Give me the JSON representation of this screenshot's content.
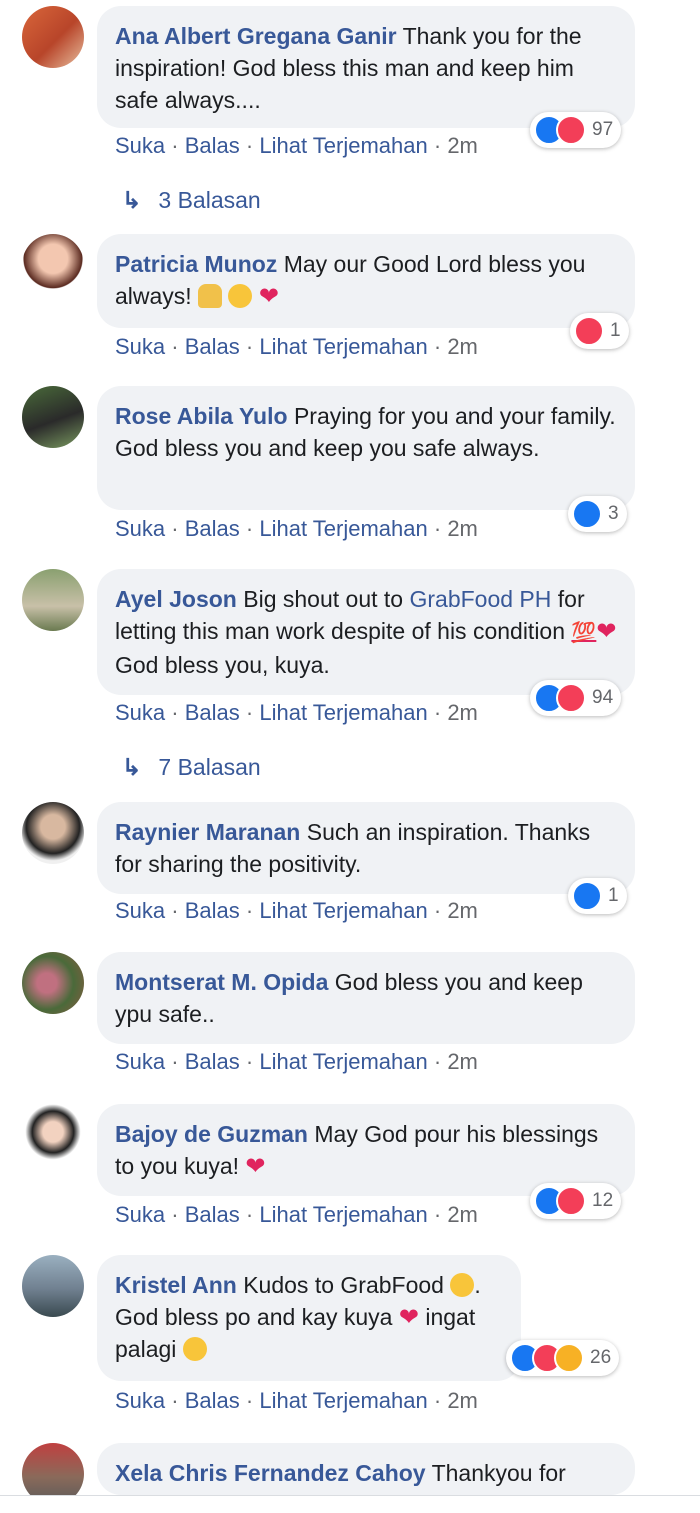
{
  "comments": [
    {
      "author": "Ana Albert Gregana Ganir",
      "text": "Thank you for the inspiration! God bless this man and keep him safe always....",
      "reactions": [
        "like",
        "love"
      ],
      "count": "97",
      "replies": "3 Balasan"
    },
    {
      "author": "Patricia Munoz",
      "text": "May our Good Lord bless you always!",
      "emojis": [
        "pray",
        "smile",
        "heart-gift"
      ],
      "reactions": [
        "love"
      ],
      "count": "1"
    },
    {
      "author": "Rose Abila Yulo",
      "text": "Praying for you and your family. God bless you and keep you safe always.",
      "reactions": [
        "like"
      ],
      "count": "3"
    },
    {
      "author": "Ayel Joson",
      "text_pre": "Big shout out to",
      "mention": "GrabFood PH",
      "text_post": "for letting this man work despite of his condition",
      "text_end": "God bless you, kuya.",
      "reactions": [
        "like",
        "love"
      ],
      "count": "94",
      "replies": "7 Balasan"
    },
    {
      "author": "Raynier Maranan",
      "text": "Such an inspiration. Thanks for sharing the positivity.",
      "reactions": [
        "like"
      ],
      "count": "1"
    },
    {
      "author": "Montserat M. Opida",
      "text": "God bless you and keep ypu safe.."
    },
    {
      "author": "Bajoy de Guzman",
      "text": "May God pour his blessings to you kuya!",
      "reactions": [
        "like",
        "love"
      ],
      "count": "12"
    },
    {
      "author": "Kristel Ann",
      "text_a": "Kudos to GrabFood",
      "text_b": ". God bless po and kay kuya",
      "text_c": "ingat palagi",
      "reactions": [
        "like",
        "love",
        "haha"
      ],
      "count": "26"
    },
    {
      "author": "Xela Chris Fernandez Cahoy",
      "text": "Thankyou for"
    }
  ],
  "actions": {
    "like": "Suka",
    "reply": "Balas",
    "translate": "Lihat Terjemahan",
    "sep": "·",
    "time": "2m"
  }
}
